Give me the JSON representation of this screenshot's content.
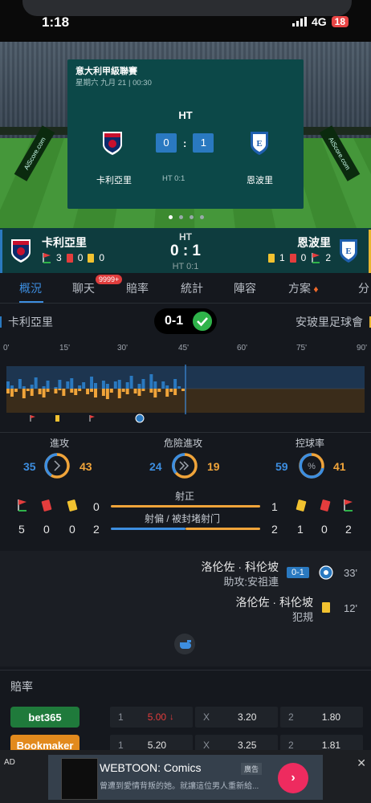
{
  "status": {
    "time": "1:18",
    "network": "4G",
    "battery": "18"
  },
  "banner": {
    "league": "意大利甲級聯賽",
    "date": "星期六 九月 21 | 00:30",
    "status": "HT",
    "home_score": "0",
    "away_score": "1",
    "ht_score": "HT 0:1",
    "home_team": "卡利亞里",
    "away_team": "恩波里",
    "board_text": "AiScore.com",
    "page_indicator": {
      "total": 4,
      "active": 1
    }
  },
  "teambar": {
    "home_name": "卡利亞里",
    "away_name": "恩波里",
    "status": "HT",
    "score": "0 : 1",
    "ht": "HT 0:1",
    "home_stats": {
      "corners": "3",
      "red": "0",
      "yellow": "0"
    },
    "away_stats": {
      "yellow": "1",
      "red": "0",
      "corners": "2"
    }
  },
  "tabs": [
    {
      "label": "概況",
      "active": true
    },
    {
      "label": "聊天",
      "badge": "9999+"
    },
    {
      "label": "賠率"
    },
    {
      "label": "統計"
    },
    {
      "label": "陣容"
    },
    {
      "label": "方案"
    },
    {
      "label": "分"
    }
  ],
  "scoreline": {
    "home": "卡利亞里",
    "score": "0-1",
    "away": "安玻里足球會"
  },
  "timeline": {
    "labels": [
      "0'",
      "15'",
      "30'",
      "45'",
      "60'",
      "75'",
      "90'"
    ],
    "current_minute": 45,
    "colors": {
      "home": "#2a79c0",
      "away": "#f0a43a"
    }
  },
  "stats": {
    "attack": {
      "label": "進攻",
      "home": "35",
      "away": "43"
    },
    "dangerous": {
      "label": "危險進攻",
      "home": "24",
      "away": "19"
    },
    "possession": {
      "label": "控球率",
      "home": "59",
      "away": "41"
    },
    "on_target": {
      "label": "射正",
      "home": "0",
      "away": "1"
    },
    "off_target": {
      "label": "射偏 / 被封堵射门",
      "home": "2",
      "away": "2"
    },
    "home_cards": {
      "corners": "5",
      "red": "0",
      "yellow": "0"
    },
    "away_cards": {
      "yellow": "1",
      "red": "0",
      "corners": "2"
    }
  },
  "events": [
    {
      "player": "洛伦佐 · 科伦坡",
      "sub": "助攻:安祖連",
      "score": "0-1",
      "minute": "33'",
      "type": "goal"
    },
    {
      "player": "洛伦佐 · 科伦坡",
      "sub": "犯規",
      "minute": "12'",
      "type": "yellow"
    }
  ],
  "odds": {
    "title": "賠率",
    "rows": [
      {
        "book": "bet365",
        "color": "#1f7a3b",
        "h_label": "1",
        "h": "5.00",
        "h_trend": "down",
        "x_label": "X",
        "x": "3.20",
        "a_label": "2",
        "a": "1.80"
      },
      {
        "book": "Bookmaker",
        "color": "#e28a1d",
        "h_label": "1",
        "h": "5.20",
        "x_label": "X",
        "x": "3.25",
        "a_label": "2",
        "a": "1.81"
      }
    ]
  },
  "ad": {
    "label": "AD",
    "title": "WEBTOON: Comics",
    "tag": "廣告",
    "desc": "曾遭到愛情背叛的她。就讓這位男人重新給...",
    "close": "✕"
  }
}
